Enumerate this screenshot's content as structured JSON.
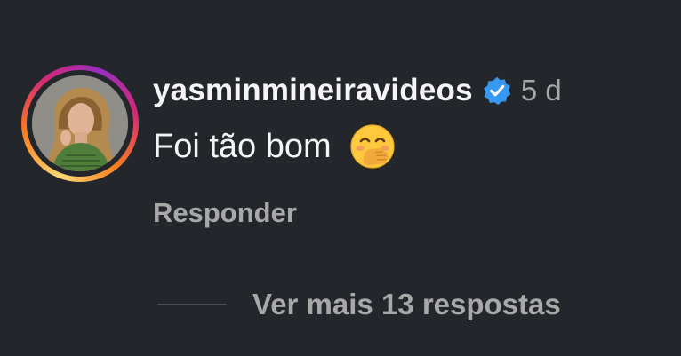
{
  "comment": {
    "username": "yasminmineiravideos",
    "verified_icon": "verified-badge-icon",
    "time": "5 d",
    "text": "Foi tão bom",
    "emoji_icon": "face-with-hand-over-mouth-icon",
    "reply_label": "Responder",
    "more_replies_label": "Ver mais 13 respostas"
  },
  "colors": {
    "background": "#23262b",
    "primary_text": "#f5f5f5",
    "secondary_text": "#a8a8a8",
    "verified_blue": "#3897f0"
  }
}
